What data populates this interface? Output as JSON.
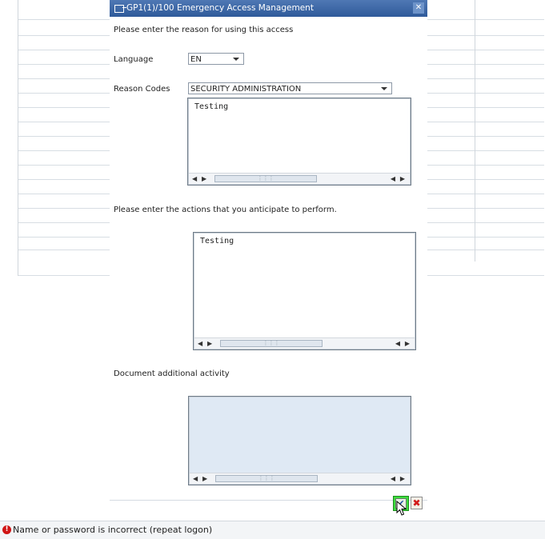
{
  "dialog": {
    "title": "GP1(1)/100 Emergency Access Management",
    "intro": "Please enter the reason for using this access",
    "language_label": "Language",
    "language_value": "EN",
    "reason_label": "Reason Codes",
    "reason_value": "SECURITY ADMINISTRATION",
    "reason_text": "Testing",
    "actions_prompt": "Please enter the actions that you anticipate to perform.",
    "actions_text": "Testing",
    "activity_label": "Document additional activity",
    "activity_text": ""
  },
  "icons": {
    "title": "window-icon",
    "close": "close-icon",
    "ok": "checkmark-icon",
    "cancel": "cancel-icon",
    "status": "error-icon"
  },
  "colors": {
    "titlebar": "#3c64a4",
    "ok_highlight": "#3ddc3d",
    "cancel": "#d21919",
    "error": "#d01515",
    "activity_bg": "#dfe9f4"
  },
  "status": {
    "message": "Name or password is incorrect (repeat logon)"
  }
}
